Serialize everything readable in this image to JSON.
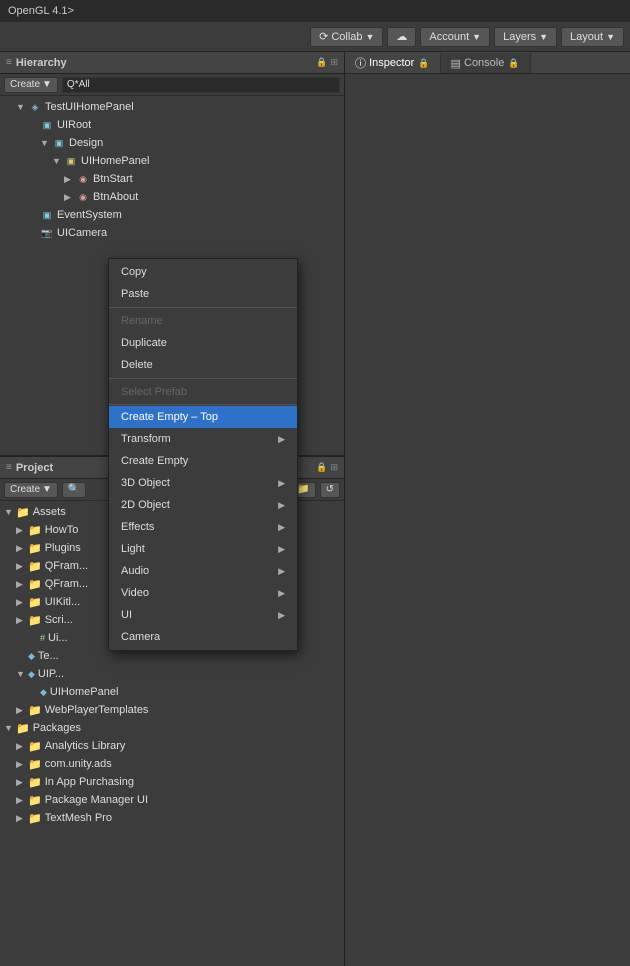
{
  "titleBar": {
    "text": "OpenGL 4.1>"
  },
  "toolbar": {
    "collab": "Collab",
    "account": "Account",
    "layers": "Layers",
    "layout": "Layout"
  },
  "hierarchy": {
    "title": "Hierarchy",
    "createBtn": "Create",
    "searchPlaceholder": "Q*All",
    "items": [
      {
        "label": "TestUIHomePanel",
        "level": 0,
        "type": "scene",
        "arrow": "▼"
      },
      {
        "label": "UIRoot",
        "level": 1,
        "type": "gameobj",
        "arrow": ""
      },
      {
        "label": "Design",
        "level": 2,
        "type": "gameobj",
        "arrow": "▼"
      },
      {
        "label": "UIHomePanel",
        "level": 3,
        "type": "canvas",
        "arrow": "▼"
      },
      {
        "label": "BtnStart",
        "level": 4,
        "type": "btn",
        "arrow": "▶"
      },
      {
        "label": "BtnAbout",
        "level": 4,
        "type": "btn",
        "arrow": "▶"
      },
      {
        "label": "EventSystem",
        "level": 1,
        "type": "gameobj",
        "arrow": ""
      },
      {
        "label": "UICamera",
        "level": 1,
        "type": "camera",
        "arrow": ""
      }
    ]
  },
  "contextMenuTop": {
    "items": [
      {
        "label": "Copy",
        "type": "normal"
      },
      {
        "label": "Paste",
        "type": "normal"
      },
      {
        "type": "separator"
      },
      {
        "label": "Rename",
        "type": "disabled"
      },
      {
        "label": "Duplicate",
        "type": "normal"
      },
      {
        "label": "Delete",
        "type": "normal"
      },
      {
        "type": "separator"
      },
      {
        "label": "Select Prefab",
        "type": "disabled"
      }
    ]
  },
  "contextMenu": {
    "items": [
      {
        "label": "Create Empty – Top",
        "type": "active"
      },
      {
        "label": "Transform",
        "type": "submenu"
      },
      {
        "label": "Create Empty",
        "type": "normal"
      },
      {
        "label": "3D Object",
        "type": "submenu"
      },
      {
        "label": "2D Object",
        "type": "submenu"
      },
      {
        "label": "Effects",
        "type": "submenu"
      },
      {
        "label": "Light",
        "type": "submenu"
      },
      {
        "label": "Audio",
        "type": "submenu"
      },
      {
        "label": "Video",
        "type": "submenu"
      },
      {
        "label": "UI",
        "type": "submenu"
      },
      {
        "label": "Camera",
        "type": "normal"
      }
    ]
  },
  "project": {
    "title": "Project",
    "createBtn": "Create",
    "items": [
      {
        "label": "Assets",
        "level": 0,
        "type": "folder",
        "arrow": "▼"
      },
      {
        "label": "HowTo",
        "level": 1,
        "type": "folder",
        "arrow": "▶"
      },
      {
        "label": "Plugins",
        "level": 1,
        "type": "folder",
        "arrow": "▶"
      },
      {
        "label": "QFram",
        "level": 1,
        "type": "folder",
        "arrow": "▶"
      },
      {
        "label": "QFram",
        "level": 1,
        "type": "folder",
        "arrow": "▶"
      },
      {
        "label": "UIKitl",
        "level": 1,
        "type": "folder",
        "arrow": "▶"
      },
      {
        "label": "Scri",
        "level": 1,
        "type": "folder",
        "arrow": "▶"
      },
      {
        "label": "Ui",
        "level": 2,
        "type": "cs",
        "arrow": ""
      },
      {
        "label": "Te",
        "level": 1,
        "type": "prefab",
        "arrow": ""
      },
      {
        "label": "UIP",
        "level": 1,
        "type": "prefab",
        "arrow": "▼"
      },
      {
        "label": "UIHomePanel",
        "level": 2,
        "type": "prefab",
        "arrow": ""
      },
      {
        "label": "WebPlayerTemplates",
        "level": 1,
        "type": "folder",
        "arrow": "▶"
      },
      {
        "label": "Packages",
        "level": 0,
        "type": "folder",
        "arrow": "▼"
      },
      {
        "label": "Analytics Library",
        "level": 1,
        "type": "folder",
        "arrow": "▶"
      },
      {
        "label": "com.unity.ads",
        "level": 1,
        "type": "folder",
        "arrow": "▶"
      },
      {
        "label": "In App Purchasing",
        "level": 1,
        "type": "folder",
        "arrow": "▶"
      },
      {
        "label": "Package Manager UI",
        "level": 1,
        "type": "folder",
        "arrow": "▶"
      },
      {
        "label": "TextMesh Pro",
        "level": 1,
        "type": "folder",
        "arrow": "▶"
      }
    ]
  },
  "inspector": {
    "title": "Inspector",
    "lockLabel": "🔒"
  },
  "console": {
    "title": "Console"
  }
}
